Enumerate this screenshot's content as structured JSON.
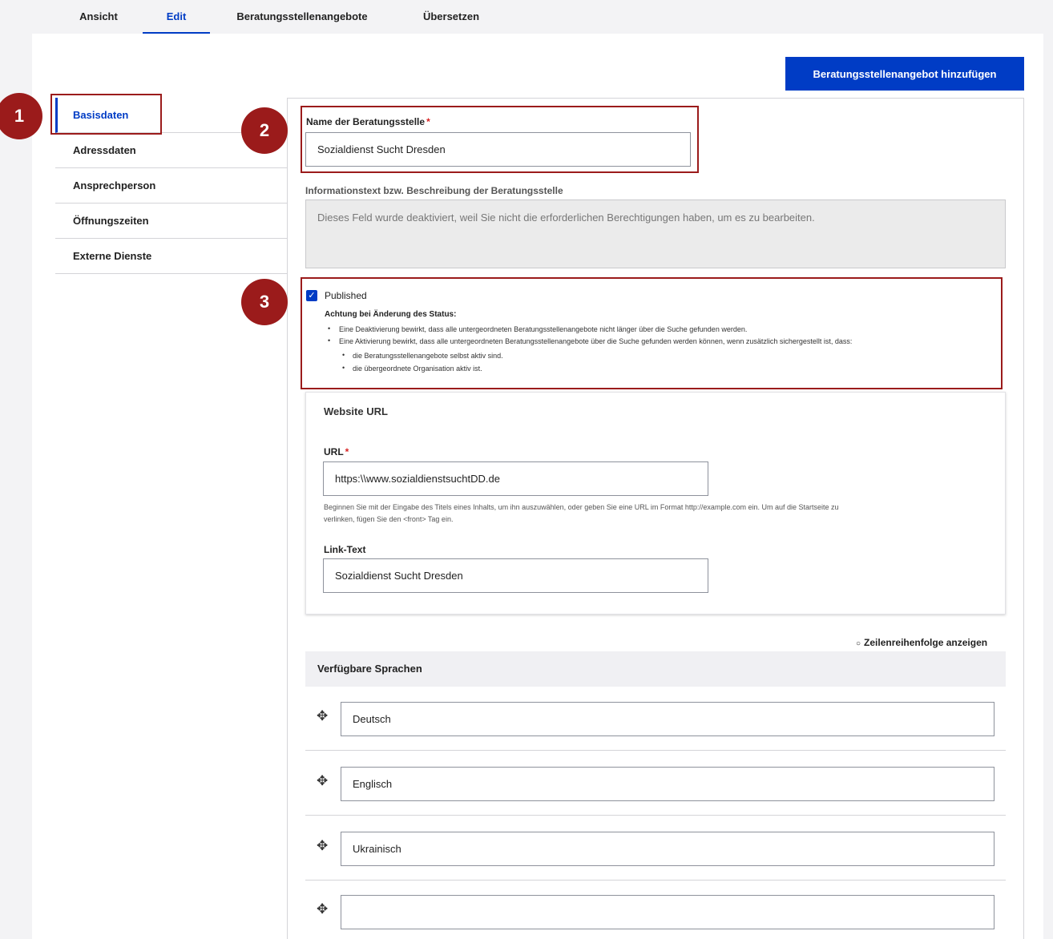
{
  "top_tabs": [
    "Ansicht",
    "Edit",
    "Beratungsstellenangebote",
    "Übersetzen"
  ],
  "add_button": "Beratungsstellenangebot hinzufügen",
  "side_tabs": [
    "Basisdaten",
    "Adressdaten",
    "Ansprechperson",
    "Öffnungszeiten",
    "Externe Dienste"
  ],
  "name_field": {
    "label": "Name der Beratungsstelle",
    "required": "*",
    "value": "Sozialdienst Sucht Dresden"
  },
  "info_field": {
    "label": "Informationstext bzw. Beschreibung der Beratungsstelle",
    "disabled_text": "Dieses Feld wurde deaktiviert, weil Sie nicht die erforderlichen Berechtigungen haben, um es zu bearbeiten."
  },
  "published": {
    "label": "Published",
    "checked": true,
    "warning_title": "Achtung bei Änderung des Status:",
    "bullets": [
      "Eine Deaktivierung bewirkt, dass alle untergeordneten Beratungsstellenangebote nicht länger über die Suche gefunden werden.",
      "Eine Aktivierung bewirkt, dass alle untergeordneten Beratungsstellenangebote über die Suche gefunden werden können, wenn zusätzlich sichergestellt ist, dass:"
    ],
    "sub_bullets": [
      "die Beratungsstellenangebote selbst aktiv sind.",
      "die übergeordnete Organisation aktiv ist."
    ]
  },
  "website": {
    "title": "Website URL",
    "url_label": "URL",
    "url_required": "*",
    "url_value": "https:\\\\www.sozialdienstsuchtDD.de",
    "help_line1": "Beginnen Sie mit der Eingabe des Titels eines Inhalts, um ihn auszuwählen, oder geben Sie eine URL im Format http://example.com ein. Um auf die Startseite zu",
    "help_line2": "verlinken, fügen Sie den <front> Tag ein.",
    "link_label": "Link-Text",
    "link_value": "Sozialdienst Sucht Dresden"
  },
  "row_order_link": "Zeilenreihenfolge anzeigen",
  "languages": {
    "header": "Verfügbare Sprachen",
    "items": [
      "Deutsch",
      "Englisch",
      "Ukrainisch",
      ""
    ]
  },
  "annotations": [
    "1",
    "2",
    "3"
  ],
  "colors": {
    "accent": "#003cc5",
    "annotation": "#9b1b1b",
    "required": "#d72222"
  }
}
